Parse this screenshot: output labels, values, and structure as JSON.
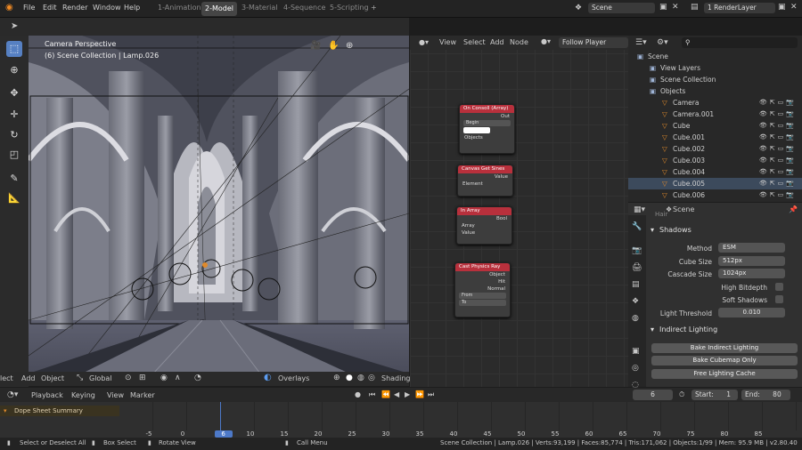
{
  "topbar": {
    "menus": [
      "File",
      "Edit",
      "Render",
      "Window",
      "Help"
    ],
    "workspaces": [
      "1-Animation",
      "2-Model",
      "3-Material",
      "4-Sequence",
      "5-Scripting"
    ],
    "active_workspace": "2-Model",
    "add_tab": "+",
    "scene_name": "Scene",
    "view_layer": "1 RenderLayer"
  },
  "viewport": {
    "header": {
      "menus": [
        "Object"
      ],
      "add": "Add",
      "select_partial": "lect",
      "transform": "Global",
      "overlays": "Overlays",
      "shading": "Shading"
    },
    "overlay_text": {
      "line1": "Camera Perspective",
      "line2": "(6) Scene Collection | Lamp.026"
    }
  },
  "node_editor": {
    "header": {
      "view": "View",
      "select": "Select",
      "add": "Add",
      "node": "Node",
      "tree": "Follow Player"
    },
    "nodes": [
      {
        "title": "On Consoll (Array)",
        "rows": [
          "Out",
          "Begin",
          "",
          "Objects"
        ]
      },
      {
        "title": "Canvas Get Sines",
        "rows": [
          "Value",
          "Element"
        ]
      },
      {
        "title": "In Array",
        "rows": [
          "Bool",
          "Array",
          "Value"
        ]
      },
      {
        "title": "Cast Physics Ray",
        "rows": [
          "Object",
          "Hit",
          "Normal",
          "From",
          "To"
        ]
      }
    ]
  },
  "outliner": {
    "search_placeholder": "",
    "items": [
      {
        "label": "Scene",
        "indent": 0
      },
      {
        "label": "View Layers",
        "indent": 1
      },
      {
        "label": "Scene Collection",
        "indent": 1
      },
      {
        "label": "Objects",
        "indent": 1
      },
      {
        "label": "Camera",
        "indent": 2
      },
      {
        "label": "Camera.001",
        "indent": 2
      },
      {
        "label": "Cube",
        "indent": 2
      },
      {
        "label": "Cube.001",
        "indent": 2
      },
      {
        "label": "Cube.002",
        "indent": 2
      },
      {
        "label": "Cube.003",
        "indent": 2
      },
      {
        "label": "Cube.004",
        "indent": 2
      },
      {
        "label": "Cube.005",
        "indent": 2,
        "selected": true
      },
      {
        "label": "Cube.006",
        "indent": 2
      }
    ]
  },
  "properties": {
    "scene": "Scene",
    "top_partial": "Hair",
    "shadows_title": "Shadows",
    "method_label": "Method",
    "method_value": "ESM",
    "cube_size_label": "Cube Size",
    "cube_size_value": "512px",
    "cascade_label": "Cascade Size",
    "cascade_value": "1024px",
    "high_bitdepth": "High Bitdepth",
    "soft_shadows": "Soft Shadows",
    "light_threshold_label": "Light Threshold",
    "light_threshold_value": "0.010",
    "indirect_title": "Indirect Lighting",
    "bake_indirect": "Bake Indirect Lighting",
    "bake_cubemap": "Bake Cubemap Only",
    "free_cache": "Free Lighting Cache"
  },
  "timeline": {
    "playback": "Playback",
    "keying": "Keying",
    "view": "View",
    "marker": "Marker",
    "current_frame": "6",
    "start_label": "Start:",
    "start": "1",
    "end_label": "End:",
    "end": "80",
    "summary": "Dope Sheet Summary",
    "ticks": [
      "-5",
      "0",
      "6",
      "10",
      "15",
      "20",
      "25",
      "30",
      "35",
      "40",
      "45",
      "50",
      "55",
      "60",
      "65",
      "70",
      "75",
      "80",
      "85"
    ]
  },
  "status": {
    "select": "Select or Deselect All",
    "box": "Box Select",
    "rotate": "Rotate View",
    "call": "Call Menu",
    "info": "Scene Collection | Lamp.026 | Verts:93,199 | Faces:85,774 | Tris:171,062 | Objects:1/99 | Mem: 95.9 MB | v2.80.40"
  },
  "colors": {
    "accent": "#5680c2",
    "node_header": "#b8303c",
    "timeline_current": "#4d79c8",
    "orange": "#e08a2b"
  }
}
